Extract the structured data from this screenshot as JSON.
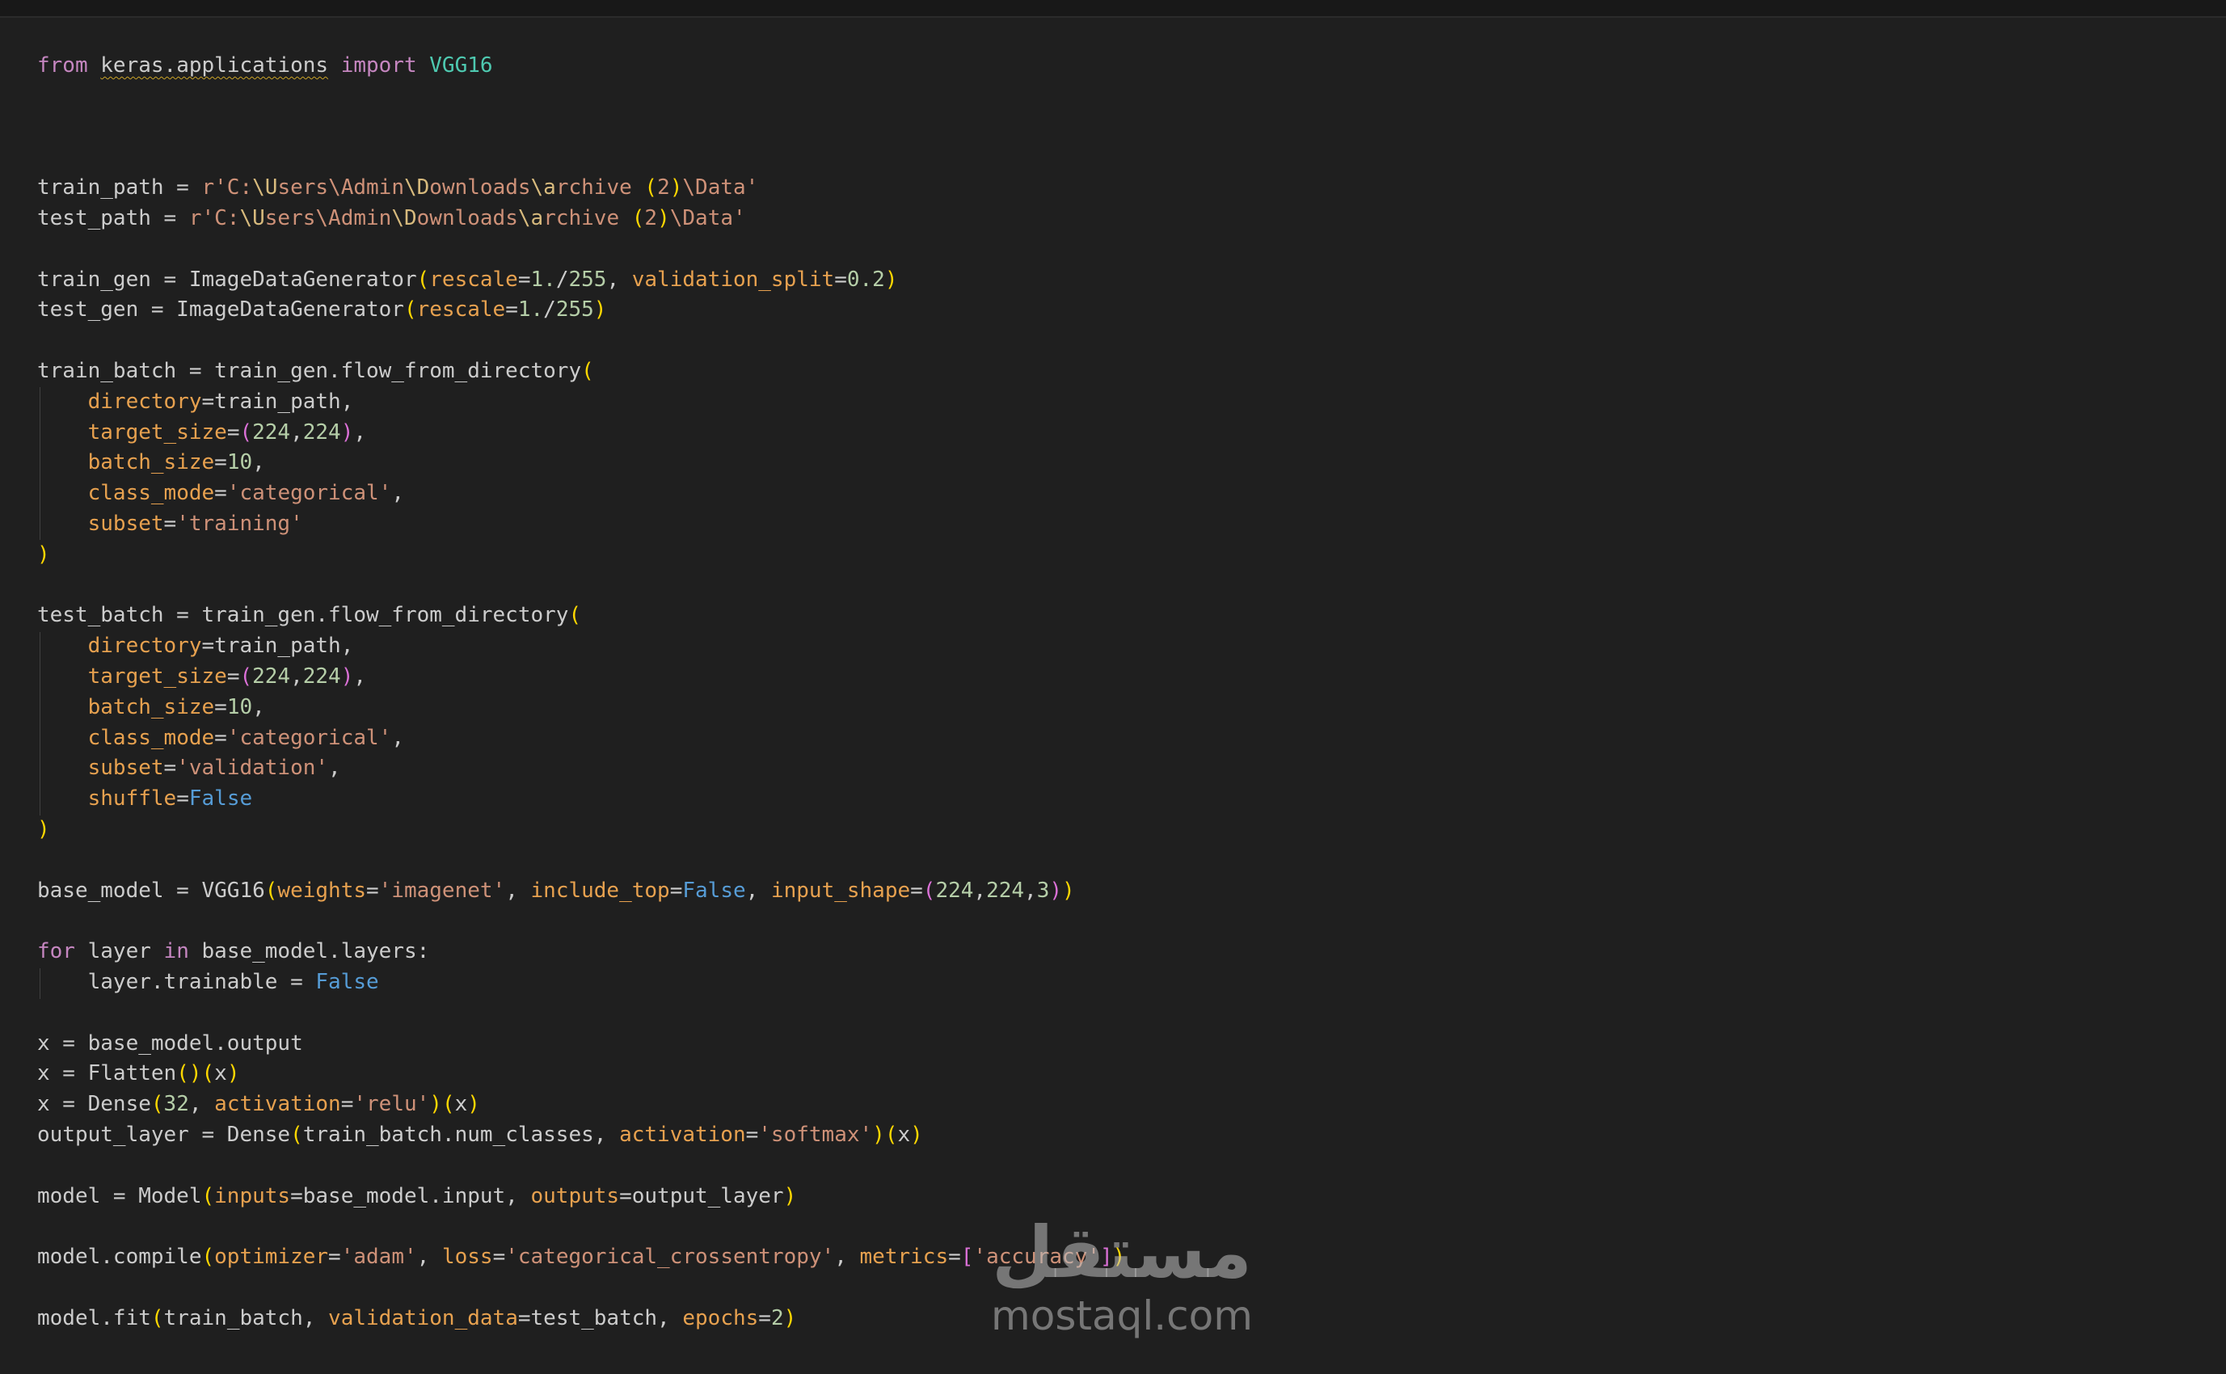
{
  "code_lines": [
    [
      {
        "t": "from",
        "c": "kw"
      },
      {
        "t": " ",
        "c": "def"
      },
      {
        "t": "keras.applications",
        "c": "sq"
      },
      {
        "t": " ",
        "c": "def"
      },
      {
        "t": "import",
        "c": "kw"
      },
      {
        "t": " ",
        "c": "def"
      },
      {
        "t": "VGG16",
        "c": "bi"
      }
    ],
    [],
    [],
    [],
    [
      {
        "t": "train_path = ",
        "c": "def"
      },
      {
        "t": "r'C:",
        "c": "str"
      },
      {
        "t": "\\U",
        "c": "esc"
      },
      {
        "t": "sers",
        "c": "str"
      },
      {
        "t": "\\Admin",
        "c": "str"
      },
      {
        "t": "\\D",
        "c": "esc"
      },
      {
        "t": "ownloads",
        "c": "str"
      },
      {
        "t": "\\a",
        "c": "esc"
      },
      {
        "t": "rchive ",
        "c": "str"
      },
      {
        "t": "(",
        "c": "p1"
      },
      {
        "t": "2",
        "c": "str"
      },
      {
        "t": ")",
        "c": "p1"
      },
      {
        "t": "\\Data'",
        "c": "str"
      }
    ],
    [
      {
        "t": "test_path = ",
        "c": "def"
      },
      {
        "t": "r'C:",
        "c": "str"
      },
      {
        "t": "\\U",
        "c": "esc"
      },
      {
        "t": "sers",
        "c": "str"
      },
      {
        "t": "\\Admin",
        "c": "str"
      },
      {
        "t": "\\D",
        "c": "esc"
      },
      {
        "t": "ownloads",
        "c": "str"
      },
      {
        "t": "\\a",
        "c": "esc"
      },
      {
        "t": "rchive ",
        "c": "str"
      },
      {
        "t": "(",
        "c": "p1"
      },
      {
        "t": "2",
        "c": "str"
      },
      {
        "t": ")",
        "c": "p1"
      },
      {
        "t": "\\Data'",
        "c": "str"
      }
    ],
    [],
    [
      {
        "t": "train_gen = ImageDataGenerator",
        "c": "def"
      },
      {
        "t": "(",
        "c": "p1"
      },
      {
        "t": "rescale",
        "c": "param"
      },
      {
        "t": "=",
        "c": "def"
      },
      {
        "t": "1.",
        "c": "num"
      },
      {
        "t": "/",
        "c": "def"
      },
      {
        "t": "255",
        "c": "num"
      },
      {
        "t": ", ",
        "c": "def"
      },
      {
        "t": "validation_split",
        "c": "param"
      },
      {
        "t": "=",
        "c": "def"
      },
      {
        "t": "0.2",
        "c": "num"
      },
      {
        "t": ")",
        "c": "p1"
      }
    ],
    [
      {
        "t": "test_gen = ImageDataGenerator",
        "c": "def"
      },
      {
        "t": "(",
        "c": "p1"
      },
      {
        "t": "rescale",
        "c": "param"
      },
      {
        "t": "=",
        "c": "def"
      },
      {
        "t": "1.",
        "c": "num"
      },
      {
        "t": "/",
        "c": "def"
      },
      {
        "t": "255",
        "c": "num"
      },
      {
        "t": ")",
        "c": "p1"
      }
    ],
    [],
    [
      {
        "t": "train_batch = train_gen.flow_from_directory",
        "c": "def"
      },
      {
        "t": "(",
        "c": "p1"
      }
    ],
    [
      {
        "t": "    ",
        "c": "def"
      },
      {
        "t": "directory",
        "c": "param"
      },
      {
        "t": "=train_path,",
        "c": "def"
      }
    ],
    [
      {
        "t": "    ",
        "c": "def"
      },
      {
        "t": "target_size",
        "c": "param"
      },
      {
        "t": "=",
        "c": "def"
      },
      {
        "t": "(",
        "c": "p2"
      },
      {
        "t": "224",
        "c": "num"
      },
      {
        "t": ",",
        "c": "def"
      },
      {
        "t": "224",
        "c": "num"
      },
      {
        "t": ")",
        "c": "p2"
      },
      {
        "t": ",",
        "c": "def"
      }
    ],
    [
      {
        "t": "    ",
        "c": "def"
      },
      {
        "t": "batch_size",
        "c": "param"
      },
      {
        "t": "=",
        "c": "def"
      },
      {
        "t": "10",
        "c": "num"
      },
      {
        "t": ",",
        "c": "def"
      }
    ],
    [
      {
        "t": "    ",
        "c": "def"
      },
      {
        "t": "class_mode",
        "c": "param"
      },
      {
        "t": "=",
        "c": "def"
      },
      {
        "t": "'categorical'",
        "c": "str"
      },
      {
        "t": ",",
        "c": "def"
      }
    ],
    [
      {
        "t": "    ",
        "c": "def"
      },
      {
        "t": "subset",
        "c": "param"
      },
      {
        "t": "=",
        "c": "def"
      },
      {
        "t": "'training'",
        "c": "str"
      }
    ],
    [
      {
        "t": ")",
        "c": "p1"
      }
    ],
    [],
    [
      {
        "t": "test_batch = train_gen.flow_from_directory",
        "c": "def"
      },
      {
        "t": "(",
        "c": "p1"
      }
    ],
    [
      {
        "t": "    ",
        "c": "def"
      },
      {
        "t": "directory",
        "c": "param"
      },
      {
        "t": "=train_path,",
        "c": "def"
      }
    ],
    [
      {
        "t": "    ",
        "c": "def"
      },
      {
        "t": "target_size",
        "c": "param"
      },
      {
        "t": "=",
        "c": "def"
      },
      {
        "t": "(",
        "c": "p2"
      },
      {
        "t": "224",
        "c": "num"
      },
      {
        "t": ",",
        "c": "def"
      },
      {
        "t": "224",
        "c": "num"
      },
      {
        "t": ")",
        "c": "p2"
      },
      {
        "t": ",",
        "c": "def"
      }
    ],
    [
      {
        "t": "    ",
        "c": "def"
      },
      {
        "t": "batch_size",
        "c": "param"
      },
      {
        "t": "=",
        "c": "def"
      },
      {
        "t": "10",
        "c": "num"
      },
      {
        "t": ",",
        "c": "def"
      }
    ],
    [
      {
        "t": "    ",
        "c": "def"
      },
      {
        "t": "class_mode",
        "c": "param"
      },
      {
        "t": "=",
        "c": "def"
      },
      {
        "t": "'categorical'",
        "c": "str"
      },
      {
        "t": ",",
        "c": "def"
      }
    ],
    [
      {
        "t": "    ",
        "c": "def"
      },
      {
        "t": "subset",
        "c": "param"
      },
      {
        "t": "=",
        "c": "def"
      },
      {
        "t": "'validation'",
        "c": "str"
      },
      {
        "t": ",",
        "c": "def"
      }
    ],
    [
      {
        "t": "    ",
        "c": "def"
      },
      {
        "t": "shuffle",
        "c": "param"
      },
      {
        "t": "=",
        "c": "def"
      },
      {
        "t": "False",
        "c": "const"
      }
    ],
    [
      {
        "t": ")",
        "c": "p1"
      }
    ],
    [],
    [
      {
        "t": "base_model = VGG16",
        "c": "def"
      },
      {
        "t": "(",
        "c": "p1"
      },
      {
        "t": "weights",
        "c": "param"
      },
      {
        "t": "=",
        "c": "def"
      },
      {
        "t": "'imagenet'",
        "c": "str"
      },
      {
        "t": ", ",
        "c": "def"
      },
      {
        "t": "include_top",
        "c": "param"
      },
      {
        "t": "=",
        "c": "def"
      },
      {
        "t": "False",
        "c": "const"
      },
      {
        "t": ", ",
        "c": "def"
      },
      {
        "t": "input_shape",
        "c": "param"
      },
      {
        "t": "=",
        "c": "def"
      },
      {
        "t": "(",
        "c": "p2"
      },
      {
        "t": "224",
        "c": "num"
      },
      {
        "t": ",",
        "c": "def"
      },
      {
        "t": "224",
        "c": "num"
      },
      {
        "t": ",",
        "c": "def"
      },
      {
        "t": "3",
        "c": "num"
      },
      {
        "t": ")",
        "c": "p2"
      },
      {
        "t": ")",
        "c": "p1"
      }
    ],
    [],
    [
      {
        "t": "for",
        "c": "kw"
      },
      {
        "t": " layer ",
        "c": "def"
      },
      {
        "t": "in",
        "c": "kw"
      },
      {
        "t": " base_model.layers:",
        "c": "def"
      }
    ],
    [
      {
        "t": "    layer.trainable = ",
        "c": "def"
      },
      {
        "t": "False",
        "c": "const"
      }
    ],
    [],
    [
      {
        "t": "x = base_model.output",
        "c": "def"
      }
    ],
    [
      {
        "t": "x = Flatten",
        "c": "def"
      },
      {
        "t": "()",
        "c": "p1"
      },
      {
        "t": "(",
        "c": "p1"
      },
      {
        "t": "x",
        "c": "def"
      },
      {
        "t": ")",
        "c": "p1"
      }
    ],
    [
      {
        "t": "x = Dense",
        "c": "def"
      },
      {
        "t": "(",
        "c": "p1"
      },
      {
        "t": "32",
        "c": "num"
      },
      {
        "t": ", ",
        "c": "def"
      },
      {
        "t": "activation",
        "c": "param"
      },
      {
        "t": "=",
        "c": "def"
      },
      {
        "t": "'relu'",
        "c": "str"
      },
      {
        "t": ")",
        "c": "p1"
      },
      {
        "t": "(",
        "c": "p1"
      },
      {
        "t": "x",
        "c": "def"
      },
      {
        "t": ")",
        "c": "p1"
      }
    ],
    [
      {
        "t": "output_layer = Dense",
        "c": "def"
      },
      {
        "t": "(",
        "c": "p1"
      },
      {
        "t": "train_batch.num_classes, ",
        "c": "def"
      },
      {
        "t": "activation",
        "c": "param"
      },
      {
        "t": "=",
        "c": "def"
      },
      {
        "t": "'softmax'",
        "c": "str"
      },
      {
        "t": ")",
        "c": "p1"
      },
      {
        "t": "(",
        "c": "p1"
      },
      {
        "t": "x",
        "c": "def"
      },
      {
        "t": ")",
        "c": "p1"
      }
    ],
    [],
    [
      {
        "t": "model = Model",
        "c": "def"
      },
      {
        "t": "(",
        "c": "p1"
      },
      {
        "t": "inputs",
        "c": "param"
      },
      {
        "t": "=base_model.input, ",
        "c": "def"
      },
      {
        "t": "outputs",
        "c": "param"
      },
      {
        "t": "=output_layer",
        "c": "def"
      },
      {
        "t": ")",
        "c": "p1"
      }
    ],
    [],
    [
      {
        "t": "model.compile",
        "c": "def"
      },
      {
        "t": "(",
        "c": "p1"
      },
      {
        "t": "optimizer",
        "c": "param"
      },
      {
        "t": "=",
        "c": "def"
      },
      {
        "t": "'adam'",
        "c": "str"
      },
      {
        "t": ", ",
        "c": "def"
      },
      {
        "t": "loss",
        "c": "param"
      },
      {
        "t": "=",
        "c": "def"
      },
      {
        "t": "'categorical_crossentropy'",
        "c": "str"
      },
      {
        "t": ", ",
        "c": "def"
      },
      {
        "t": "metrics",
        "c": "param"
      },
      {
        "t": "=",
        "c": "def"
      },
      {
        "t": "[",
        "c": "p2"
      },
      {
        "t": "'accuracy'",
        "c": "str"
      },
      {
        "t": "]",
        "c": "p2"
      },
      {
        "t": ")",
        "c": "p1"
      }
    ],
    [],
    [
      {
        "t": "model.fit",
        "c": "def"
      },
      {
        "t": "(",
        "c": "p1"
      },
      {
        "t": "train_batch, ",
        "c": "def"
      },
      {
        "t": "validation_data",
        "c": "param"
      },
      {
        "t": "=test_batch, ",
        "c": "def"
      },
      {
        "t": "epochs",
        "c": "param"
      },
      {
        "t": "=",
        "c": "def"
      },
      {
        "t": "2",
        "c": "num"
      },
      {
        "t": ")",
        "c": "p1"
      }
    ]
  ],
  "colors": {
    "background": "#1f1f1f",
    "keyword": "#c586c0",
    "class": "#4ec9b0",
    "default": "#cccccc",
    "string": "#ce9178",
    "number": "#b5cea8",
    "constant": "#569cd6",
    "parameter": "#e7a14f",
    "bracket_1": "#ffd700",
    "bracket_2": "#da70d6"
  },
  "watermark": {
    "logo_text": "مستقل",
    "site_text": "mostaql.com"
  }
}
